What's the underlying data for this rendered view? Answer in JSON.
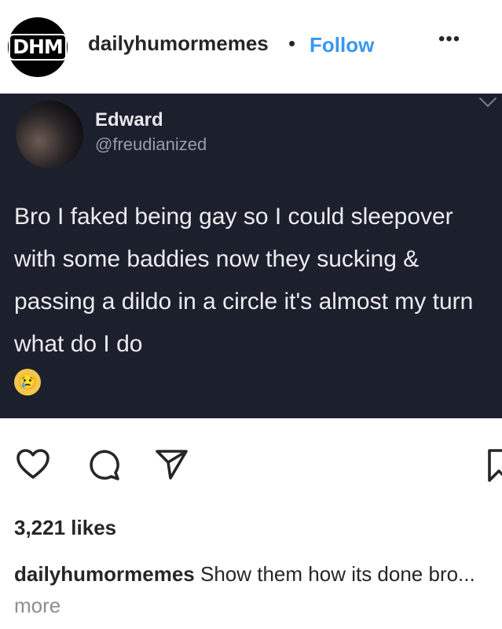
{
  "header": {
    "avatar_text": "DHM",
    "username": "dailyhumormemes",
    "separator": "•",
    "follow_label": "Follow",
    "options": "•••"
  },
  "tweet": {
    "name": "Edward",
    "handle": "@freudianized",
    "text": "Bro I faked being gay so I could sleepover with some baddies now they sucking & passing a dildo in a circle it's almost my turn what do I do",
    "emoji": "😢"
  },
  "actions": {
    "icons": [
      "heart-icon",
      "comment-icon",
      "share-icon",
      "bookmark-icon"
    ]
  },
  "likes": "3,221 likes",
  "caption": {
    "username": "dailyhumormemes",
    "text": "Show them how its done bro...",
    "more": "more"
  },
  "colors": {
    "follow": "#3897f0",
    "post_bg": "#1c1f2c",
    "text": "#262626",
    "muted": "#8e8e8e"
  }
}
